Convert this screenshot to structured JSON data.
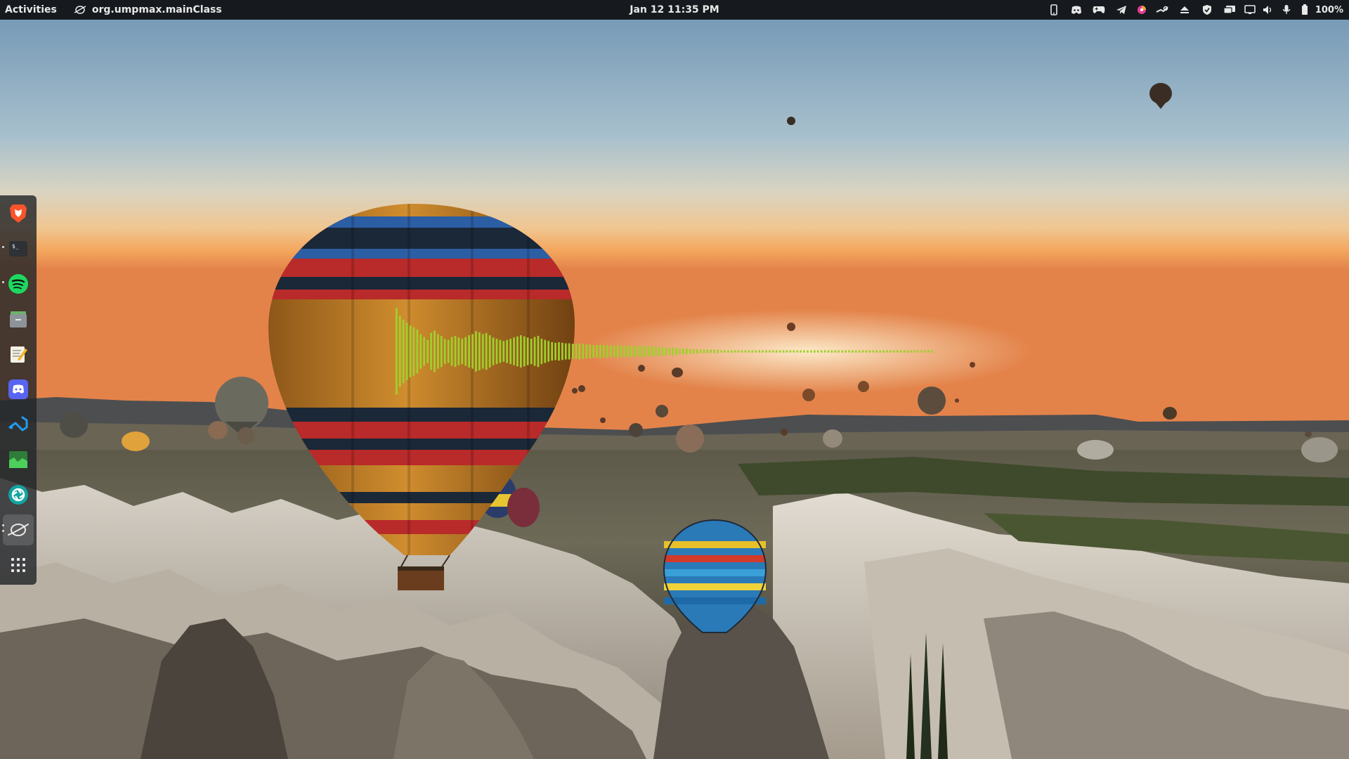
{
  "topbar": {
    "activities_label": "Activities",
    "focused_app": "org.umpmax.mainClass",
    "clock": "Jan 12  11:35 PM",
    "battery": "100%",
    "tray_icons": [
      "phone-icon",
      "discord-tray-icon",
      "gamepad-icon",
      "telegram-icon",
      "color-picker-icon",
      "steam-icon",
      "eject-icon",
      "vpn-shield-icon",
      "display-icon",
      "screen-icon",
      "volume-icon",
      "microphone-icon",
      "battery-icon"
    ]
  },
  "dock": {
    "items": [
      {
        "name": "brave-browser",
        "active": false,
        "running": false
      },
      {
        "name": "terminal",
        "active": false,
        "running": true
      },
      {
        "name": "spotify",
        "active": false,
        "running": true
      },
      {
        "name": "files",
        "active": false,
        "running": false
      },
      {
        "name": "text-editor",
        "active": false,
        "running": false
      },
      {
        "name": "discord",
        "active": false,
        "running": false
      },
      {
        "name": "vscode",
        "active": false,
        "running": false
      },
      {
        "name": "system-monitor",
        "active": false,
        "running": false
      },
      {
        "name": "ark-cleaner",
        "active": false,
        "running": false
      },
      {
        "name": "umpmax",
        "active": true,
        "running": true
      },
      {
        "name": "show-applications",
        "active": false,
        "running": false
      }
    ]
  },
  "visualizer": {
    "color": "#9fd02d",
    "levels": [
      0.75,
      0.62,
      0.55,
      0.5,
      0.45,
      0.42,
      0.38,
      0.3,
      0.25,
      0.2,
      0.32,
      0.36,
      0.3,
      0.27,
      0.22,
      0.2,
      0.25,
      0.27,
      0.24,
      0.22,
      0.25,
      0.28,
      0.3,
      0.35,
      0.33,
      0.3,
      0.32,
      0.28,
      0.24,
      0.22,
      0.2,
      0.18,
      0.2,
      0.22,
      0.24,
      0.26,
      0.28,
      0.26,
      0.24,
      0.22,
      0.25,
      0.27,
      0.22,
      0.2,
      0.18,
      0.16,
      0.15,
      0.16,
      0.15,
      0.14,
      0.14,
      0.13,
      0.13,
      0.14,
      0.13,
      0.12,
      0.12,
      0.11,
      0.11,
      0.12,
      0.11,
      0.11,
      0.1,
      0.1,
      0.11,
      0.1,
      0.1,
      0.09,
      0.1,
      0.09,
      0.09,
      0.1,
      0.09,
      0.08,
      0.09,
      0.08,
      0.08,
      0.07,
      0.07,
      0.06,
      0.07,
      0.06,
      0.05,
      0.05,
      0.05,
      0.04,
      0.04,
      0.04,
      0.03,
      0.03,
      0.03,
      0.03,
      0.03,
      0.03,
      0.02,
      0.02,
      0.02,
      0.02,
      0.02,
      0.02,
      0.02,
      0.02,
      0.02,
      0.02,
      0.02,
      0.02,
      0.02,
      0.02,
      0.02,
      0.02,
      0.02,
      0.02,
      0.02,
      0.02,
      0.02,
      0.02,
      0.02,
      0.02,
      0.02,
      0.02,
      0.02,
      0.02,
      0.02,
      0.02,
      0.02,
      0.02,
      0.02,
      0.02,
      0.02,
      0.02,
      0.02,
      0.02,
      0.02,
      0.02,
      0.02,
      0.02,
      0.02,
      0.02,
      0.02,
      0.02,
      0.02,
      0.02,
      0.02,
      0.02,
      0.02,
      0.02,
      0.02,
      0.02,
      0.02,
      0.02,
      0.02,
      0.02,
      0.02,
      0.02,
      0.02,
      0.02
    ]
  }
}
